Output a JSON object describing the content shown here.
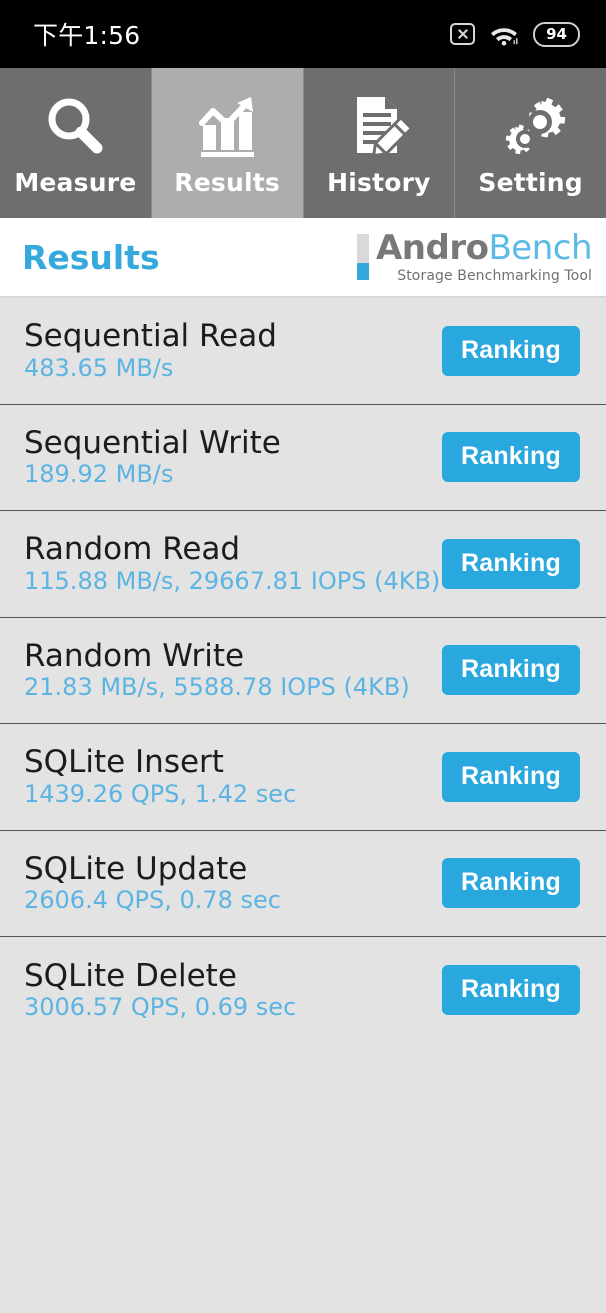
{
  "statusbar": {
    "time": "下午1:56",
    "battery_level": "94",
    "icons": [
      "mute-icon",
      "wifi-icon",
      "battery-icon"
    ]
  },
  "tabs": [
    {
      "label": "Measure",
      "icon": "magnifier-icon",
      "active": false
    },
    {
      "label": "Results",
      "icon": "bar-chart-arrow-icon",
      "active": true
    },
    {
      "label": "History",
      "icon": "document-pencil-icon",
      "active": false
    },
    {
      "label": "Setting",
      "icon": "gears-icon",
      "active": false
    }
  ],
  "header": {
    "title": "Results",
    "logo_andro": "Andro",
    "logo_bench": "Bench",
    "logo_tagline": "Storage Benchmarking Tool"
  },
  "colors": {
    "accent_blue": "#29a8de",
    "value_blue": "#5bb4e2",
    "title_blue": "#35a9dc",
    "tab_inactive": "#6e6e6e",
    "tab_active": "#adadad",
    "list_bg": "#e4e3e3"
  },
  "results": [
    {
      "name": "Sequential Read",
      "value": "483.65 MB/s",
      "button": "Ranking"
    },
    {
      "name": "Sequential Write",
      "value": "189.92 MB/s",
      "button": "Ranking"
    },
    {
      "name": "Random Read",
      "value": "115.88 MB/s, 29667.81 IOPS (4KB)",
      "button": "Ranking"
    },
    {
      "name": "Random Write",
      "value": "21.83 MB/s, 5588.78 IOPS (4KB)",
      "button": "Ranking"
    },
    {
      "name": "SQLite Insert",
      "value": "1439.26 QPS, 1.42 sec",
      "button": "Ranking"
    },
    {
      "name": "SQLite Update",
      "value": "2606.4 QPS, 0.78 sec",
      "button": "Ranking"
    },
    {
      "name": "SQLite Delete",
      "value": "3006.57 QPS, 0.69 sec",
      "button": "Ranking"
    }
  ]
}
